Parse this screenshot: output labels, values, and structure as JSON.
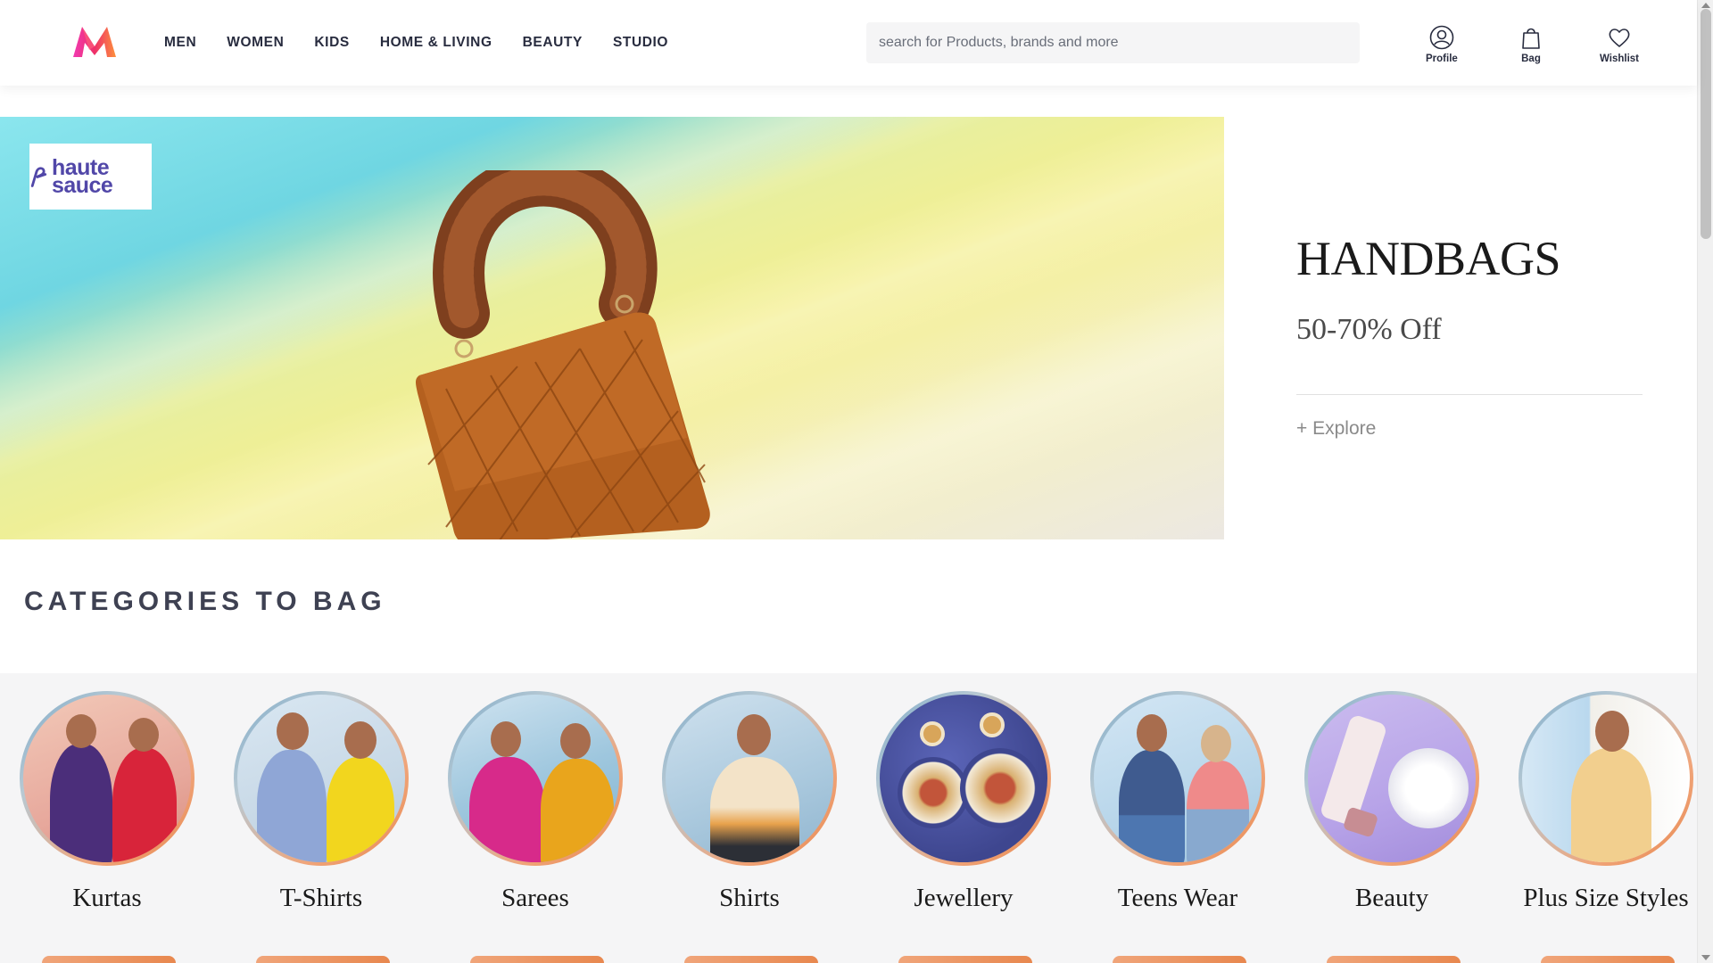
{
  "header": {
    "logo_name": "myntra-logo",
    "nav": [
      "MEN",
      "WOMEN",
      "KIDS",
      "HOME & LIVING",
      "BEAUTY",
      "STUDIO"
    ],
    "search_placeholder": "search for Products, brands and more",
    "actions": {
      "profile": "Profile",
      "bag": "Bag",
      "wishlist": "Wishlist"
    }
  },
  "banner": {
    "brand": "haute sauce",
    "title": "HANDBAGS",
    "offer": "50-70% Off",
    "cta": "+ Explore",
    "colors": {
      "cyan": "#7fdde8",
      "yellow": "#f3ee95",
      "bag": "#b8621f",
      "fur": "#8a4a26"
    }
  },
  "categories": {
    "heading": "CATEGORIES TO BAG",
    "items": [
      {
        "label": "Kurtas"
      },
      {
        "label": "T-Shirts"
      },
      {
        "label": "Sarees"
      },
      {
        "label": "Shirts"
      },
      {
        "label": "Jewellery"
      },
      {
        "label": "Teens Wear"
      },
      {
        "label": "Beauty"
      },
      {
        "label": "Plus Size Styles"
      }
    ]
  }
}
